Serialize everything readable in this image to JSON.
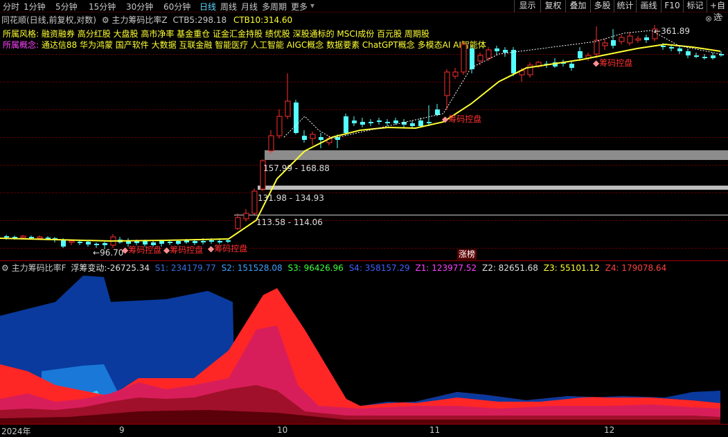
{
  "periods": [
    "分时",
    "1分钟",
    "5分钟",
    "15分钟",
    "30分钟",
    "60分钟",
    "日线",
    "周线",
    "月线",
    "多周期",
    "更多"
  ],
  "active_period": "日线",
  "right_buttons": [
    "显示",
    "复权",
    "叠加",
    "多股",
    "统计",
    "画线",
    "F10",
    "标记",
    "+自选"
  ],
  "title": {
    "prefix": "同花顺(日线,前复权,对数)",
    "indicator": "主力筹码比率Z",
    "ctb5_label": "CTB5:",
    "ctb5_value": "298.18",
    "ctb10_label": "CTB10:",
    "ctb10_value": "314.60"
  },
  "style": {
    "label": "所属风格:",
    "text": "融资融券 高分红股 大盘股 高市净率 基金重仓 证金汇金持股 绩优股 深股通标的 MSCI成份 百元股 周期股"
  },
  "concept": {
    "label": "所属概念:",
    "text": "通达信88 华为鸿蒙 国产软件 大数据 互联金融 智能医疗 人工智能 AIGC概念 数据要素 ChatGPT概念 多模态AI AI智能体"
  },
  "price_labels": {
    "high": "361.89",
    "low": "96.70",
    "zone1": "157.99 - 168.88",
    "zone2": "131.98 - 134.93",
    "zone3": "113.58 - 114.06"
  },
  "chip_label": "筹码控盘",
  "zhangbang": "涨榜",
  "sub": {
    "name": "主力筹码比率F",
    "float_label": "浮筹变动:",
    "float_value": "-26725.34",
    "s1": "S1: 234179.77",
    "s2": "S2: 151528.08",
    "s3": "S3: 96426.96",
    "s4": "S4: 358157.29",
    "z1": "Z1: 123977.52",
    "z2": "Z2: 82651.68",
    "z3": "Z3: 55101.12",
    "z4": "Z4: 179078.64"
  },
  "x_axis": {
    "year": "2024年",
    "m9": "9",
    "m10": "10",
    "m11": "11",
    "m12": "12"
  },
  "colors": {
    "up": "#ff3030",
    "down": "#54ffff",
    "ma": "#ffff33",
    "s1": "#0a3a9e",
    "s2": "#1a78d8",
    "s3": "#30d8ff",
    "z1": "#ff2626",
    "z2": "#d81e5a",
    "z3": "#a0102a",
    "z4": "#5a0008"
  }
}
